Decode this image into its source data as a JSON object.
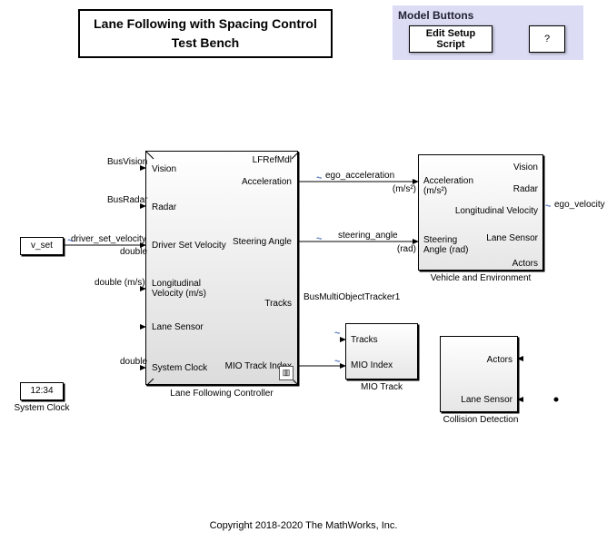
{
  "title_line1": "Lane Following with Spacing Control",
  "title_line2": "Test Bench",
  "panel": {
    "title": "Model Buttons",
    "edit_btn": "Edit Setup Script",
    "help_btn": "?"
  },
  "constant": {
    "vset": "v_set",
    "clock": "12:34"
  },
  "labels": {
    "system_clock_block": "System Clock",
    "controller": "Lane Following Controller",
    "mio": "MIO Track",
    "veh": "Vehicle and Environment",
    "coll": "Collision Detection"
  },
  "signals": {
    "bus_vision": "BusVision",
    "bus_radar": "BusRadar",
    "driver_set_velocity": "driver_set_velocity",
    "double": "double",
    "double_ms": "double (m/s)",
    "ego_acceleration": "ego_acceleration",
    "ms2": "(m/s²)",
    "steering_angle": "steering_angle",
    "rad": "(rad)",
    "bus_tracker": "BusMultiObjectTracker1",
    "ego_velocity": "ego_velocity"
  },
  "ctrl": {
    "ref": "LFRefMdl",
    "in_vision": "Vision",
    "in_radar": "Radar",
    "in_driver": "Driver Set Velocity",
    "in_longvel": "Longitudinal Velocity (m/s)",
    "in_lane": "Lane Sensor",
    "in_clock": "System Clock",
    "out_accel": "Acceleration",
    "out_steer": "Steering Angle",
    "out_tracks": "Tracks",
    "out_mio": "MIO Track Index"
  },
  "mio": {
    "in_tracks": "Tracks",
    "in_idx": "MIO Index"
  },
  "veh": {
    "in_accel": "Acceleration (m/s²)",
    "in_steer": "Steering Angle (rad)",
    "out_vision": "Vision",
    "out_radar": "Radar",
    "out_longvel": "Longitudinal Velocity",
    "out_lane": "Lane Sensor",
    "out_actors": "Actors"
  },
  "coll": {
    "in_actors": "Actors",
    "in_lane": "Lane Sensor"
  },
  "copyright": "Copyright 2018-2020 The MathWorks, Inc.",
  "chart_data": {
    "type": "block-diagram",
    "blocks": [
      {
        "id": "vset_const",
        "type": "Constant",
        "param": "v_set"
      },
      {
        "id": "system_clock",
        "type": "DigitalClock",
        "display": "12:34"
      },
      {
        "id": "controller",
        "type": "ModelReference",
        "ref": "LFRefMdl",
        "name": "Lane Following Controller",
        "inports": [
          "Vision",
          "Radar",
          "Driver Set Velocity",
          "Longitudinal Velocity (m/s)",
          "Lane Sensor",
          "System Clock"
        ],
        "outports": [
          "Acceleration",
          "Steering Angle",
          "Tracks",
          "MIO Track Index"
        ]
      },
      {
        "id": "mio_track",
        "type": "Subsystem",
        "name": "MIO Track",
        "inports": [
          "Tracks",
          "MIO Index"
        ]
      },
      {
        "id": "veh_env",
        "type": "Subsystem",
        "name": "Vehicle and Environment",
        "inports": [
          "Acceleration (m/s^2)",
          "Steering Angle (rad)"
        ],
        "outports": [
          "Vision",
          "Radar",
          "Longitudinal Velocity",
          "Lane Sensor",
          "Actors"
        ]
      },
      {
        "id": "collision",
        "type": "Subsystem",
        "name": "Collision Detection",
        "inports": [
          "Actors",
          "Lane Sensor"
        ]
      }
    ],
    "connections": [
      {
        "from": "veh_env.Vision",
        "to": "controller.Vision",
        "label": "BusVision"
      },
      {
        "from": "veh_env.Radar",
        "to": "controller.Radar",
        "label": "BusRadar"
      },
      {
        "from": "vset_const",
        "to": "controller.Driver Set Velocity",
        "label": "driver_set_velocity",
        "dtype": "double"
      },
      {
        "from": "veh_env.Longitudinal Velocity",
        "to": "controller.Longitudinal Velocity (m/s)",
        "label": "ego_velocity",
        "dtype": "double (m/s)"
      },
      {
        "from": "veh_env.Lane Sensor",
        "to": "controller.Lane Sensor"
      },
      {
        "from": "system_clock",
        "to": "controller.System Clock",
        "dtype": "double"
      },
      {
        "from": "controller.Acceleration",
        "to": "veh_env.Acceleration (m/s^2)",
        "label": "ego_acceleration"
      },
      {
        "from": "controller.Steering Angle",
        "to": "veh_env.Steering Angle (rad)",
        "label": "steering_angle"
      },
      {
        "from": "controller.Tracks",
        "to": "mio_track.Tracks",
        "label": "BusMultiObjectTracker1"
      },
      {
        "from": "controller.MIO Track Index",
        "to": "mio_track.MIO Index"
      },
      {
        "from": "veh_env.Actors",
        "to": "collision.Actors"
      },
      {
        "from": "veh_env.Lane Sensor",
        "to": "collision.Lane Sensor"
      }
    ]
  }
}
